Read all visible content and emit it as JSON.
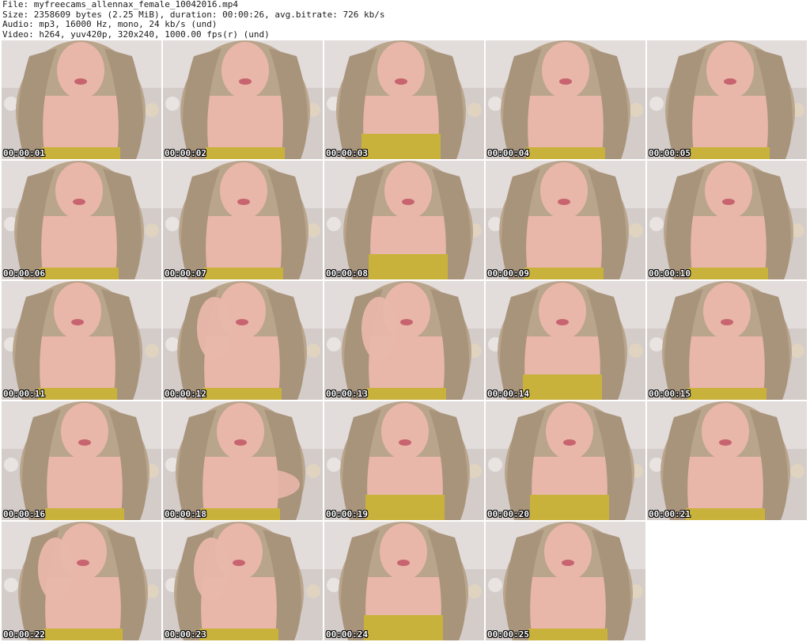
{
  "header": {
    "file": "File: myfreecams_allennax_female_10042016.mp4",
    "size": "Size: 2358609 bytes (2.25 MiB), duration: 00:00:26, avg.bitrate: 726 kb/s",
    "audio": "Audio: mp3, 16000 Hz, mono, 24 kb/s (und)",
    "video": "Video: h264, yuv420p, 320x240, 1000.00 fps(r) (und)"
  },
  "thumbnails": [
    {
      "timestamp": "00:00:01",
      "variant": "a"
    },
    {
      "timestamp": "00:00:02",
      "variant": "a"
    },
    {
      "timestamp": "00:00:03",
      "variant": "b"
    },
    {
      "timestamp": "00:00:04",
      "variant": "a"
    },
    {
      "timestamp": "00:00:05",
      "variant": "a"
    },
    {
      "timestamp": "00:00:06",
      "variant": "a"
    },
    {
      "timestamp": "00:00:07",
      "variant": "a"
    },
    {
      "timestamp": "00:00:08",
      "variant": "b"
    },
    {
      "timestamp": "00:00:09",
      "variant": "a"
    },
    {
      "timestamp": "00:00:10",
      "variant": "a"
    },
    {
      "timestamp": "00:00:11",
      "variant": "a"
    },
    {
      "timestamp": "00:00:12",
      "variant": "c"
    },
    {
      "timestamp": "00:00:13",
      "variant": "c"
    },
    {
      "timestamp": "00:00:14",
      "variant": "b"
    },
    {
      "timestamp": "00:00:15",
      "variant": "a"
    },
    {
      "timestamp": "00:00:16",
      "variant": "a"
    },
    {
      "timestamp": "00:00:18",
      "variant": "d"
    },
    {
      "timestamp": "00:00:19",
      "variant": "b"
    },
    {
      "timestamp": "00:00:20",
      "variant": "b"
    },
    {
      "timestamp": "00:00:21",
      "variant": "a"
    },
    {
      "timestamp": "00:00:22",
      "variant": "c"
    },
    {
      "timestamp": "00:00:23",
      "variant": "c"
    },
    {
      "timestamp": "00:00:24",
      "variant": "b"
    },
    {
      "timestamp": "00:00:25",
      "variant": "a"
    }
  ],
  "colors": {
    "background": "#ffffff",
    "wall": "#d3ccc9",
    "hair": "#b9a48c",
    "skin": "#e8b7aa",
    "top": "#c9b23c"
  }
}
